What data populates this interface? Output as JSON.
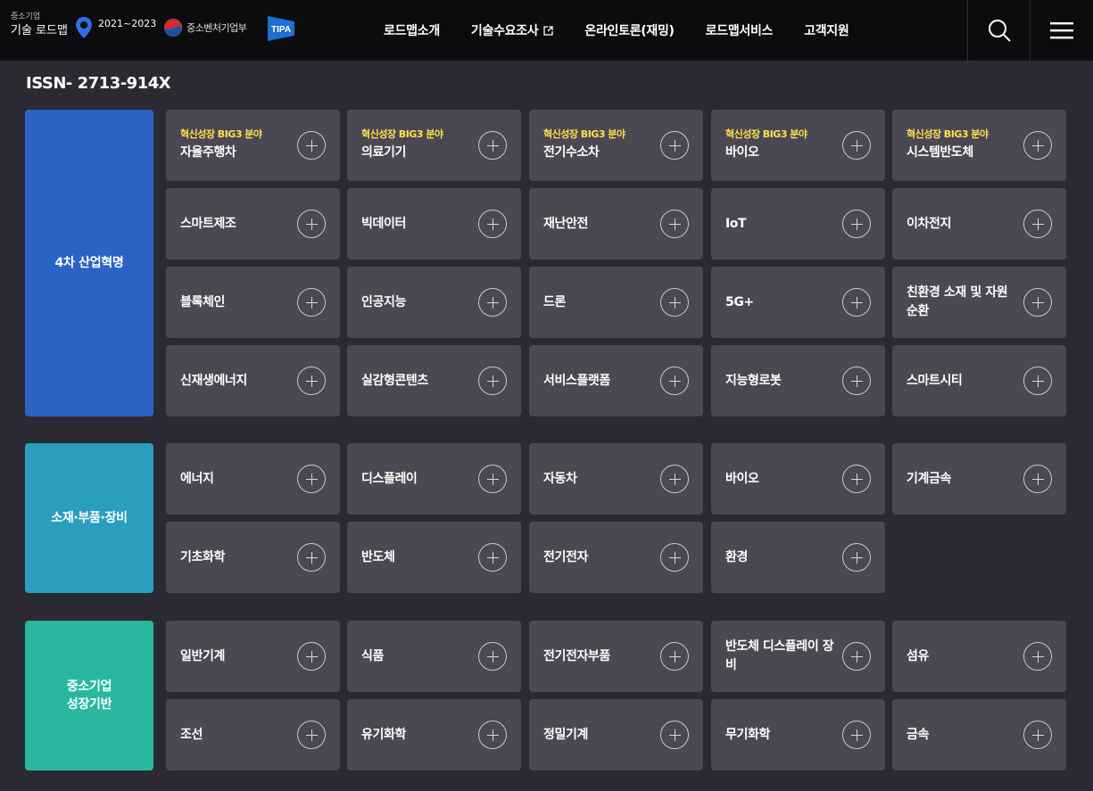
{
  "header": {
    "logo_sub": "중소기업",
    "logo_main": "기술 로드맵",
    "logo_years": "2021~2023",
    "ministry_label": "중소벤처기업부",
    "nav": [
      {
        "label": "로드맵소개"
      },
      {
        "label": "기술수요조사",
        "external": true
      },
      {
        "label": "온라인토론(재밍)"
      },
      {
        "label": "로드맵서비스"
      },
      {
        "label": "고객지원"
      }
    ]
  },
  "issn": "ISSN- 2713-914X",
  "colors": {
    "section1": "#2a63c4",
    "section2": "#2a9fbd",
    "section3": "#29b7a0",
    "tag": "#ffe14d",
    "card_bg": "#4a4853"
  },
  "sections": [
    {
      "label": "4차 산업혁명",
      "cards": [
        {
          "tag": "혁신성장 BIG3 분야",
          "title": "자율주행차"
        },
        {
          "tag": "혁신성장 BIG3 분야",
          "title": "의료기기"
        },
        {
          "tag": "혁신성장 BIG3 분야",
          "title": "전기수소차"
        },
        {
          "tag": "혁신성장 BIG3 분야",
          "title": "바이오"
        },
        {
          "tag": "혁신성장 BIG3 분야",
          "title": "시스템반도체"
        },
        {
          "title": "스마트제조"
        },
        {
          "title": "빅데이터"
        },
        {
          "title": "재난안전"
        },
        {
          "title": "IoT"
        },
        {
          "title": "이차전지"
        },
        {
          "title": "블록체인"
        },
        {
          "title": "인공지능"
        },
        {
          "title": "드론"
        },
        {
          "title": "5G+"
        },
        {
          "title": "친환경 소재 및 자원순환"
        },
        {
          "title": "신재생에너지"
        },
        {
          "title": "실감형콘텐츠"
        },
        {
          "title": "서비스플랫폼"
        },
        {
          "title": "지능형로봇"
        },
        {
          "title": "스마트시티"
        }
      ]
    },
    {
      "label": "소재·부품·장비",
      "cards": [
        {
          "title": "에너지"
        },
        {
          "title": "디스플레이"
        },
        {
          "title": "자동차"
        },
        {
          "title": "바이오"
        },
        {
          "title": "기계금속"
        },
        {
          "title": "기초화학"
        },
        {
          "title": "반도체"
        },
        {
          "title": "전기전자"
        },
        {
          "title": "환경"
        }
      ]
    },
    {
      "label": "중소기업 성장기반",
      "cards": [
        {
          "title": "일반기계"
        },
        {
          "title": "식품"
        },
        {
          "title": "전기전자부품"
        },
        {
          "title": "반도체 디스플레이 장비"
        },
        {
          "title": "섬유"
        },
        {
          "title": "조선"
        },
        {
          "title": "유기화학"
        },
        {
          "title": "정밀기계"
        },
        {
          "title": "무기화학"
        },
        {
          "title": "금속"
        }
      ]
    }
  ]
}
